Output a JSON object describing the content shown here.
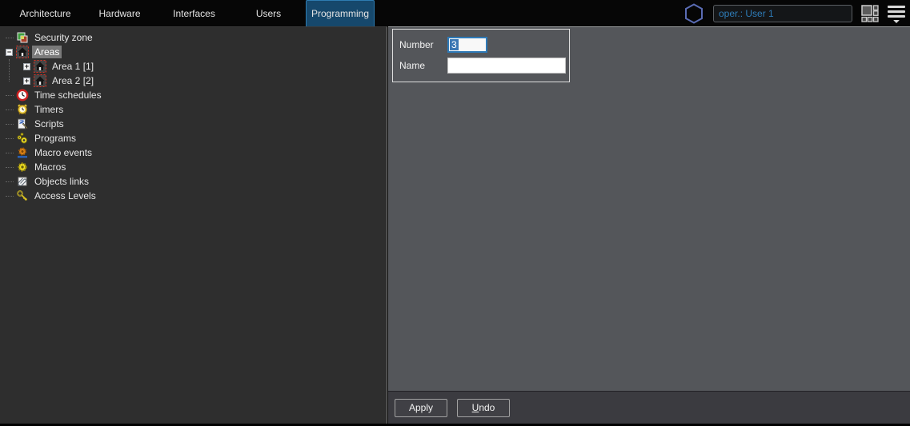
{
  "nav": {
    "tabs": [
      {
        "label": "Architecture",
        "active": false
      },
      {
        "label": "Hardware",
        "active": false
      },
      {
        "label": "Interfaces",
        "active": false
      },
      {
        "label": "Users",
        "active": false
      },
      {
        "label": "Programming",
        "active": true
      }
    ],
    "user_field_value": "oper.: User 1",
    "logo_icon": "hexagon-icon",
    "layout_icon": "grid-layout-icon",
    "menu_icon": "hamburger-menu-icon"
  },
  "colors": {
    "accent_blue": "#2e7cb8",
    "tab_active_bg": "#16486c",
    "tab_active_border": "#2e7cb2",
    "right_panel_gray": "#54565a",
    "tree_panel_gray": "#2e2e2e",
    "footer_gray": "#3b3b40",
    "selection_blue": "#3c78b4",
    "tree_selected_gray": "#7a7a7a"
  },
  "tree": {
    "items": [
      {
        "label": "Security zone",
        "icon": "security-zone-icon",
        "level": 0,
        "expand": null,
        "selected": false
      },
      {
        "label": "Areas",
        "icon": "area-house-icon",
        "level": 0,
        "expand": "minus",
        "selected": true
      },
      {
        "label": "Area 1 [1]",
        "icon": "area-house-icon",
        "level": 1,
        "expand": "plus",
        "selected": false
      },
      {
        "label": "Area 2 [2]",
        "icon": "area-house-icon",
        "level": 1,
        "expand": "plus",
        "selected": false
      },
      {
        "label": "Time schedules",
        "icon": "time-schedule-icon",
        "level": 0,
        "expand": null,
        "selected": false
      },
      {
        "label": "Timers",
        "icon": "timer-clock-icon",
        "level": 0,
        "expand": null,
        "selected": false
      },
      {
        "label": "Scripts",
        "icon": "script-icon",
        "level": 0,
        "expand": null,
        "selected": false
      },
      {
        "label": "Programs",
        "icon": "programs-icon",
        "level": 0,
        "expand": null,
        "selected": false
      },
      {
        "label": "Macro events",
        "icon": "macro-events-icon",
        "level": 0,
        "expand": null,
        "selected": false
      },
      {
        "label": "Macros",
        "icon": "macros-icon",
        "level": 0,
        "expand": null,
        "selected": false
      },
      {
        "label": "Objects links",
        "icon": "objects-links-icon",
        "level": 0,
        "expand": null,
        "selected": false
      },
      {
        "label": "Access Levels",
        "icon": "access-levels-icon",
        "level": 0,
        "expand": null,
        "selected": false
      }
    ]
  },
  "form": {
    "number_label": "Number",
    "number_value": "3",
    "name_label": "Name",
    "name_value": ""
  },
  "footer": {
    "apply_label": "Apply",
    "undo_label": "Undo"
  }
}
